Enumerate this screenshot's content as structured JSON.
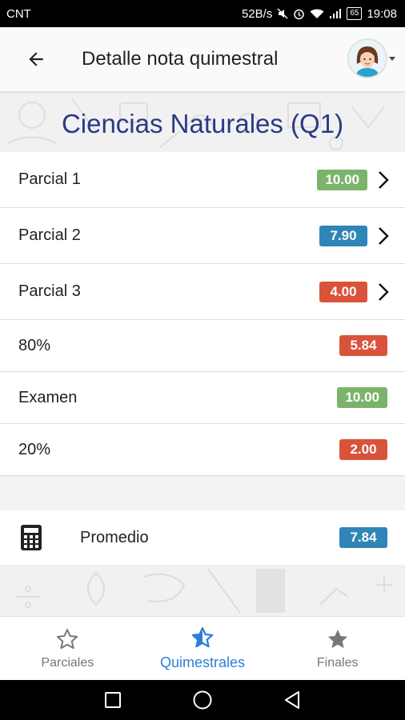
{
  "status_bar": {
    "carrier": "CNT",
    "network_speed": "52B/s",
    "battery_level": "65",
    "time": "19:08"
  },
  "app_bar": {
    "title": "Detalle nota quimestral"
  },
  "subject": {
    "title": "Ciencias Naturales (Q1)"
  },
  "grades": [
    {
      "label": "Parcial 1",
      "value": "10.00",
      "color": "#7cb36b",
      "has_arrow": true
    },
    {
      "label": "Parcial 2",
      "value": "7.90",
      "color": "#2f86b6",
      "has_arrow": true
    },
    {
      "label": "Parcial 3",
      "value": "4.00",
      "color": "#d9533b",
      "has_arrow": true
    },
    {
      "label": "80%",
      "value": "5.84",
      "color": "#d9533b",
      "has_arrow": false
    },
    {
      "label": "Examen",
      "value": "10.00",
      "color": "#7cb36b",
      "has_arrow": false
    },
    {
      "label": "20%",
      "value": "2.00",
      "color": "#d9533b",
      "has_arrow": false
    }
  ],
  "average": {
    "label": "Promedio",
    "value": "7.84",
    "color": "#2f86b6",
    "icon": "calculator-icon"
  },
  "bottom_nav": {
    "items": [
      {
        "label": "Parciales",
        "icon": "star-outline-icon",
        "active": false
      },
      {
        "label": "Quimestrales",
        "icon": "star-half-icon",
        "active": true
      },
      {
        "label": "Finales",
        "icon": "star-filled-icon",
        "active": false
      }
    ]
  },
  "colors": {
    "accent": "#2e7fd6",
    "subject_title": "#2b3a86",
    "green": "#7cb36b",
    "blue": "#2f86b6",
    "red": "#d9533b"
  }
}
